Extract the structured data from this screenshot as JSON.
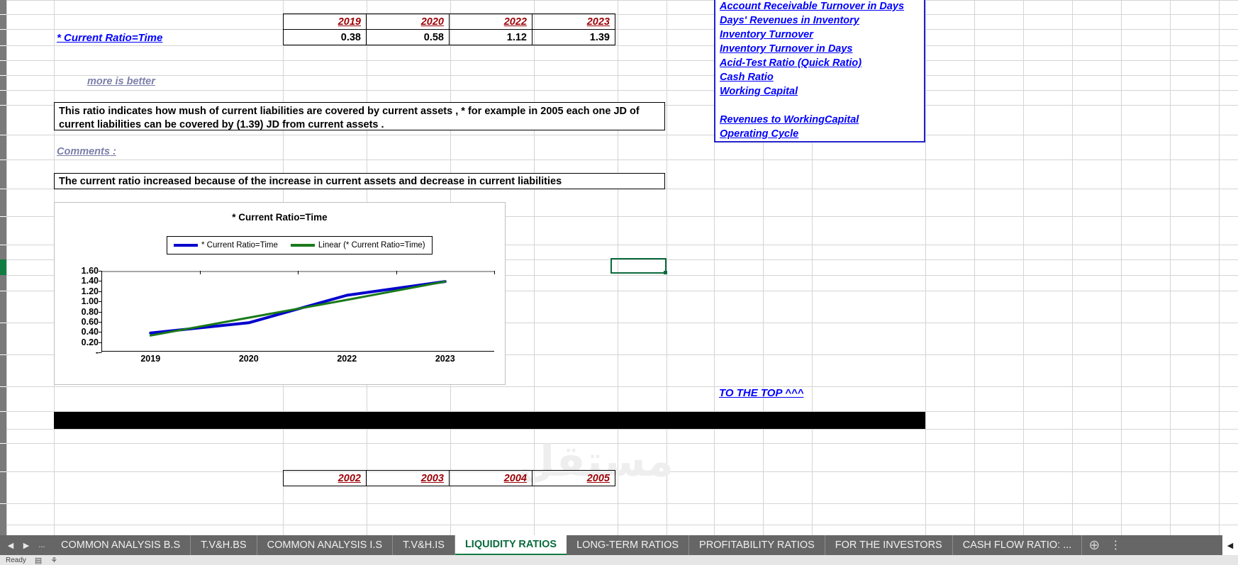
{
  "ratio_table": {
    "headers": [
      "2019",
      "2020",
      "2022",
      "2023"
    ],
    "values": [
      "0.38",
      "0.58",
      "1.12",
      "1.39"
    ]
  },
  "row_label": "* Current Ratio=Time",
  "hint_label": "more is better",
  "definition_box": "This ratio indicates how mush of current liabilities are covered by current assets , * for example in 2005 each one JD of current liabilities can be covered by (1.39) JD from current assets .",
  "comments_label": "Comments :",
  "comments_box": "The current ratio increased because of the increase in current assets and decrease in current liabilities",
  "to_the_top": "TO THE TOP ^^^",
  "nav_panel": {
    "links": [
      "Account Receivable Turnover in Days",
      "Days' Revenues in Inventory",
      "Inventory Turnover",
      "Inventory Turnover in Days",
      "Acid-Test Ratio (Quick Ratio)",
      "Cash Ratio",
      "Working Capital"
    ],
    "links2": [
      "Revenues to WorkingCapital",
      "Operating Cycle"
    ]
  },
  "lower_table": {
    "headers": [
      "2002",
      "2003",
      "2004",
      "2005"
    ]
  },
  "watermark": "مستقل",
  "chart_data": {
    "type": "line",
    "title": "* Current Ratio=Time",
    "xlabel": "",
    "ylabel": "",
    "categories": [
      "2019",
      "2020",
      "2022",
      "2023"
    ],
    "ytick_labels": [
      "1.60",
      "1.40",
      "1.20",
      "1.00",
      "0.80",
      "0.60",
      "0.40",
      "0.20",
      "-"
    ],
    "ylim": [
      0,
      1.6
    ],
    "grid": false,
    "legend_position": "top-center",
    "series": [
      {
        "name": "* Current Ratio=Time",
        "color": "#0000cc",
        "values": [
          0.38,
          0.58,
          1.12,
          1.39
        ]
      },
      {
        "name": "Linear (* Current Ratio=Time)",
        "color": "#1a7a1a",
        "values": [
          0.33,
          0.68,
          1.03,
          1.39
        ]
      }
    ]
  },
  "tabs": {
    "items": [
      {
        "label": "COMMON ANALYSIS B.S",
        "active": false
      },
      {
        "label": "T.V&H.BS",
        "active": false
      },
      {
        "label": "COMMON ANALYSIS I.S",
        "active": false
      },
      {
        "label": "T.V&H.IS",
        "active": false
      },
      {
        "label": "LIQUIDITY RATIOS",
        "active": true
      },
      {
        "label": "LONG-TERM RATIOS",
        "active": false
      },
      {
        "label": "PROFITABILITY RATIOS",
        "active": false
      },
      {
        "label": "FOR THE INVESTORS",
        "active": false
      },
      {
        "label": "CASH FLOW RATIO: ...",
        "active": false
      }
    ],
    "prev_icon": "◀",
    "next_icon": "▶",
    "more_icon": "...",
    "add_icon": "⊕",
    "menu_icon": "⋮",
    "scroll_left_icon": "◀"
  },
  "colors": {
    "link": "#0000ff",
    "header_red": "#9c0006",
    "series_blue": "#0000cc",
    "series_green": "#1a7a1a",
    "active_tab": "#0a6b3d",
    "tabbar_bg": "#666666"
  }
}
